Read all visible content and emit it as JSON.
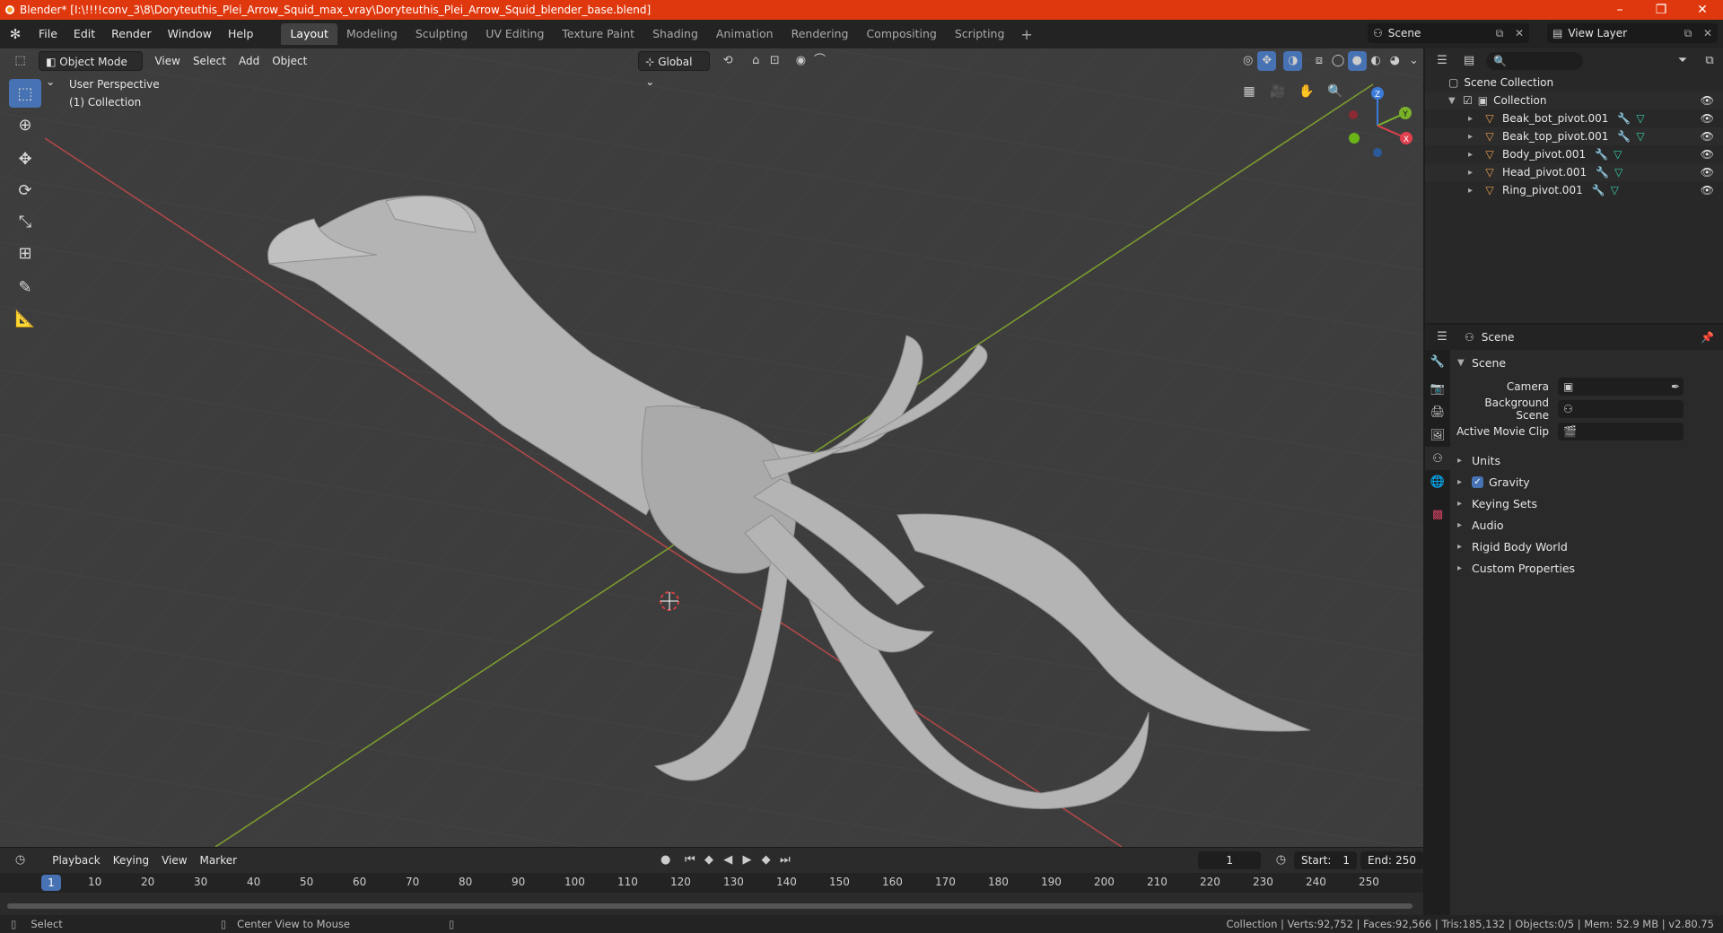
{
  "window": {
    "title": "Blender* [I:\\!!!!conv_3\\8\\Doryteuthis_Plei_Arrow_Squid_max_vray\\Doryteuthis_Plei_Arrow_Squid_blender_base.blend]",
    "minimize": "–",
    "restore": "❐",
    "close": "✕"
  },
  "menu": [
    "File",
    "Edit",
    "Render",
    "Window",
    "Help"
  ],
  "workspaces": [
    "Layout",
    "Modeling",
    "Sculpting",
    "UV Editing",
    "Texture Paint",
    "Shading",
    "Animation",
    "Rendering",
    "Compositing",
    "Scripting"
  ],
  "active_workspace": "Layout",
  "scene_selector": "Scene",
  "view_layer_selector": "View Layer",
  "viewport": {
    "mode": "Object Mode",
    "menus": [
      "View",
      "Select",
      "Add",
      "Object"
    ],
    "transform_orientation": "Global",
    "overlay_line1": "User Perspective",
    "overlay_line2": "(1) Collection",
    "gizmo_labels": {
      "x": "X",
      "y": "Y",
      "z": "Z"
    }
  },
  "timeline": {
    "menus": [
      "Playback",
      "Keying",
      "View",
      "Marker"
    ],
    "current_frame": "1",
    "start_label": "Start:",
    "start_value": "1",
    "end_label": "End:",
    "end_value": "250",
    "ticks": [
      "10",
      "20",
      "30",
      "40",
      "50",
      "60",
      "70",
      "80",
      "90",
      "100",
      "110",
      "120",
      "130",
      "140",
      "150",
      "160",
      "170",
      "180",
      "190",
      "200",
      "210",
      "220",
      "230",
      "240",
      "250"
    ],
    "playhead": "1"
  },
  "status": {
    "left_action": "Select",
    "mid_action": "Center View to Mouse",
    "stats": "Collection | Verts:92,752 | Faces:92,566 | Tris:185,132 | Objects:0/5 | Mem: 52.9 MB | v2.80.75"
  },
  "outliner": {
    "root": "Scene Collection",
    "collection": "Collection",
    "objects": [
      "Beak_bot_pivot.001",
      "Beak_top_pivot.001",
      "Body_pivot.001",
      "Head_pivot.001",
      "Ring_pivot.001"
    ]
  },
  "properties": {
    "header": "Scene",
    "panel": "Scene",
    "fields": [
      {
        "label": "Camera"
      },
      {
        "label": "Background Scene"
      },
      {
        "label": "Active Movie Clip"
      }
    ],
    "subpanels": [
      "Units",
      "Gravity",
      "Keying Sets",
      "Audio",
      "Rigid Body World",
      "Custom Properties"
    ]
  }
}
